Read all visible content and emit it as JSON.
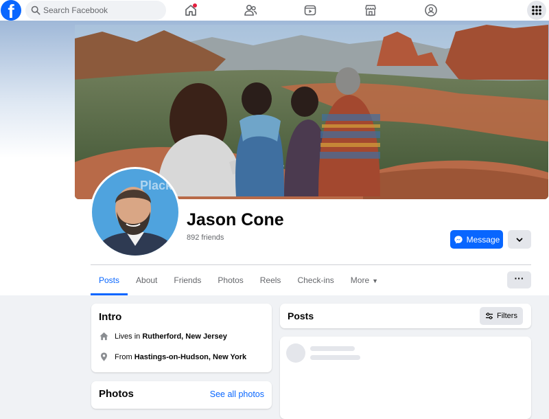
{
  "topbar": {
    "logo": "f",
    "search_placeholder": "Search Facebook",
    "nav_icons": [
      "home-icon",
      "friends-icon",
      "watch-icon",
      "marketplace-icon",
      "groups-icon"
    ],
    "menu_icon": "grid-menu-icon",
    "notification_dot_color": "#e41e3f"
  },
  "profile": {
    "name": "Jason Cone",
    "friends": "892 friends",
    "message_label": "Message",
    "more_icon": "chevron-down-icon"
  },
  "tabs": [
    {
      "label": "Posts",
      "active": true
    },
    {
      "label": "About"
    },
    {
      "label": "Friends"
    },
    {
      "label": "Photos"
    },
    {
      "label": "Reels"
    },
    {
      "label": "Check-ins"
    },
    {
      "label": "More"
    }
  ],
  "intro": {
    "title": "Intro",
    "lives_prefix": "Lives in",
    "lives_place": "Rutherford, New Jersey",
    "from_prefix": "From",
    "from_place": "Hastings-on-Hudson, New York"
  },
  "photos": {
    "title": "Photos",
    "see_all": "See all photos"
  },
  "posts": {
    "title": "Posts",
    "filters_label": "Filters"
  },
  "colors": {
    "brand": "#0866ff",
    "background": "#f0f2f5",
    "secondary_button": "#e4e6eb",
    "secondary_text": "#65676b"
  }
}
